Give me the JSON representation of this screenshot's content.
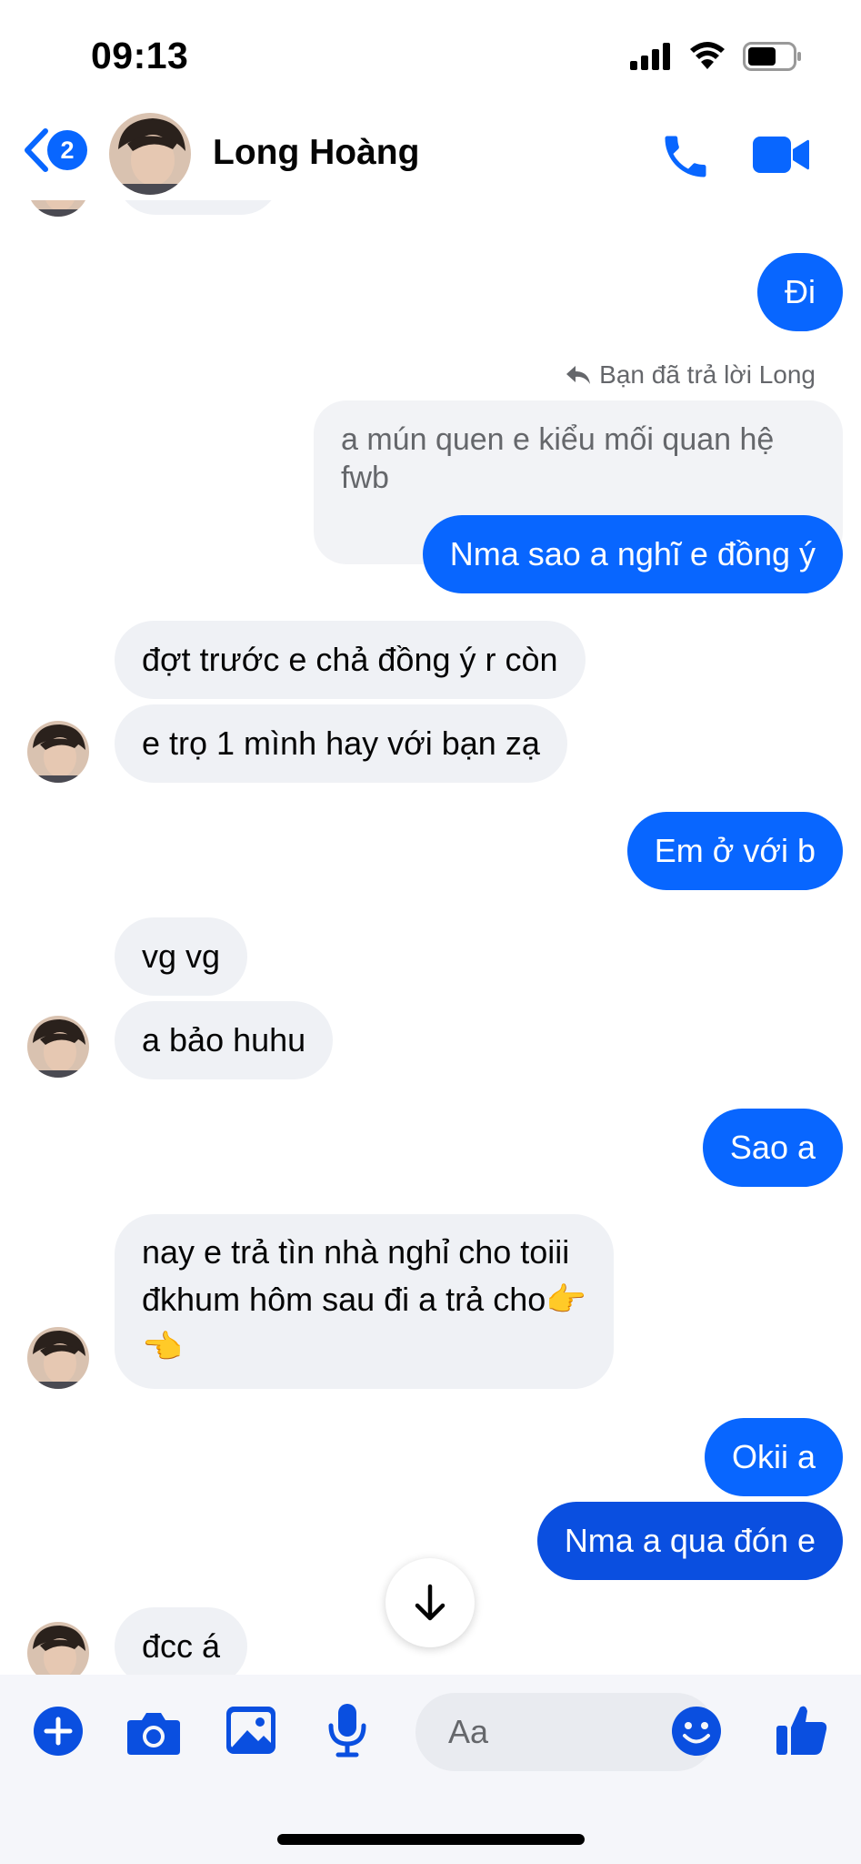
{
  "status_bar": {
    "time": "09:13"
  },
  "header": {
    "back_badge_count": "2",
    "contact_name": "Long Hoàng"
  },
  "messages": {
    "m0": "Đi",
    "reply_label": "Bạn đã trả lời Long",
    "quoted": "a mún quen e kiểu mối quan hệ fwb",
    "m1": "Nma sao a nghĩ e đồng ý",
    "m2": "đợt trước e chả đồng ý r còn",
    "m3": "e trọ 1 mình hay với bạn zạ",
    "m4": "Em ở với b",
    "m5": "vg vg",
    "m6": "a bảo huhu",
    "m7": "Sao a",
    "m8_line1": "nay e trả tìn nhà nghỉ cho toiii",
    "m8_line2": "đkhum hôm sau đi a trả cho👉",
    "m8_line3": "👈",
    "m9": "Okii a",
    "m10": "Nma a qua đón e",
    "m11": "đcc á"
  },
  "composer": {
    "placeholder": "Aa"
  },
  "colors": {
    "accent": "#0866ff",
    "incoming_bubble": "#eff1f5"
  }
}
